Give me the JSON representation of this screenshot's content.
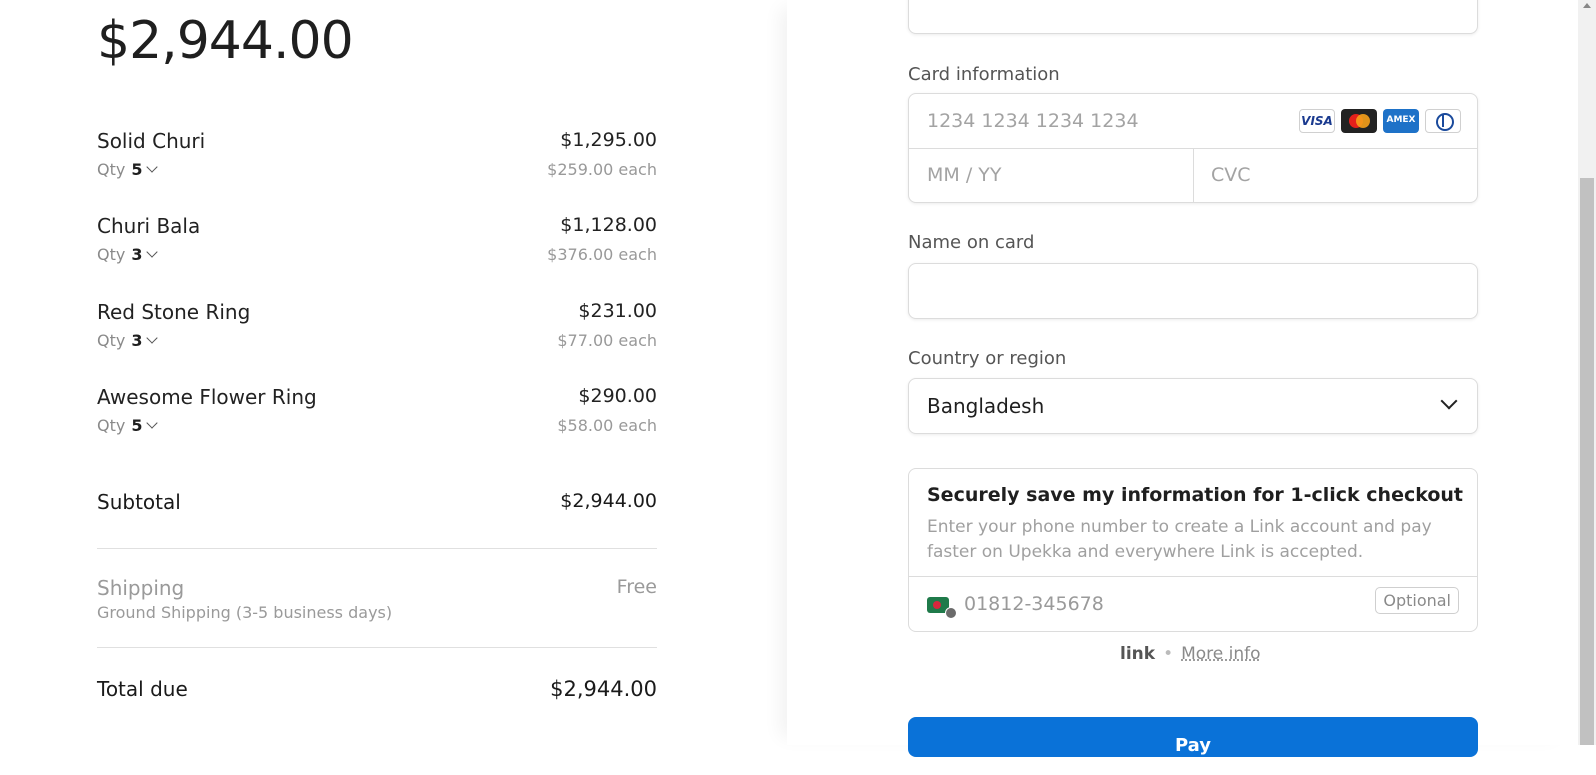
{
  "summary": {
    "total_amount": "$2,944.00",
    "items": [
      {
        "name": "Solid Churi",
        "qty_label": "Qty",
        "qty": "5",
        "total": "$1,295.00",
        "each": "$259.00 each"
      },
      {
        "name": "Churi Bala",
        "qty_label": "Qty",
        "qty": "3",
        "total": "$1,128.00",
        "each": "$376.00 each"
      },
      {
        "name": "Red Stone Ring",
        "qty_label": "Qty",
        "qty": "3",
        "total": "$231.00",
        "each": "$77.00 each"
      },
      {
        "name": "Awesome Flower Ring",
        "qty_label": "Qty",
        "qty": "5",
        "total": "$290.00",
        "each": "$58.00 each"
      }
    ],
    "subtotal_label": "Subtotal",
    "subtotal_value": "$2,944.00",
    "shipping_label": "Shipping",
    "shipping_method": "Ground Shipping (3-5 business days)",
    "shipping_value": "Free",
    "total_due_label": "Total due",
    "total_due_value": "$2,944.00"
  },
  "payment": {
    "card_label": "Card information",
    "card_number_placeholder": "1234 1234 1234 1234",
    "expiry_placeholder": "MM / YY",
    "cvc_placeholder": "CVC",
    "card_brands": [
      "VISA",
      "mastercard",
      "AMEX",
      "diners"
    ],
    "name_label": "Name on card",
    "name_value": "",
    "country_label": "Country or region",
    "country_value": "Bangladesh",
    "link_title": "Securely save my information for 1-click checkout",
    "link_desc": "Enter your phone number to create a Link account and pay faster on Upekka and everywhere Link is accepted.",
    "phone_placeholder": "01812-345678",
    "optional_label": "Optional",
    "link_logo": "link",
    "more_info": "More info",
    "pay_label": "Pay"
  },
  "colors": {
    "accent": "#0a72d8",
    "text": "#1a1a1a",
    "muted": "#8a8a8a"
  }
}
